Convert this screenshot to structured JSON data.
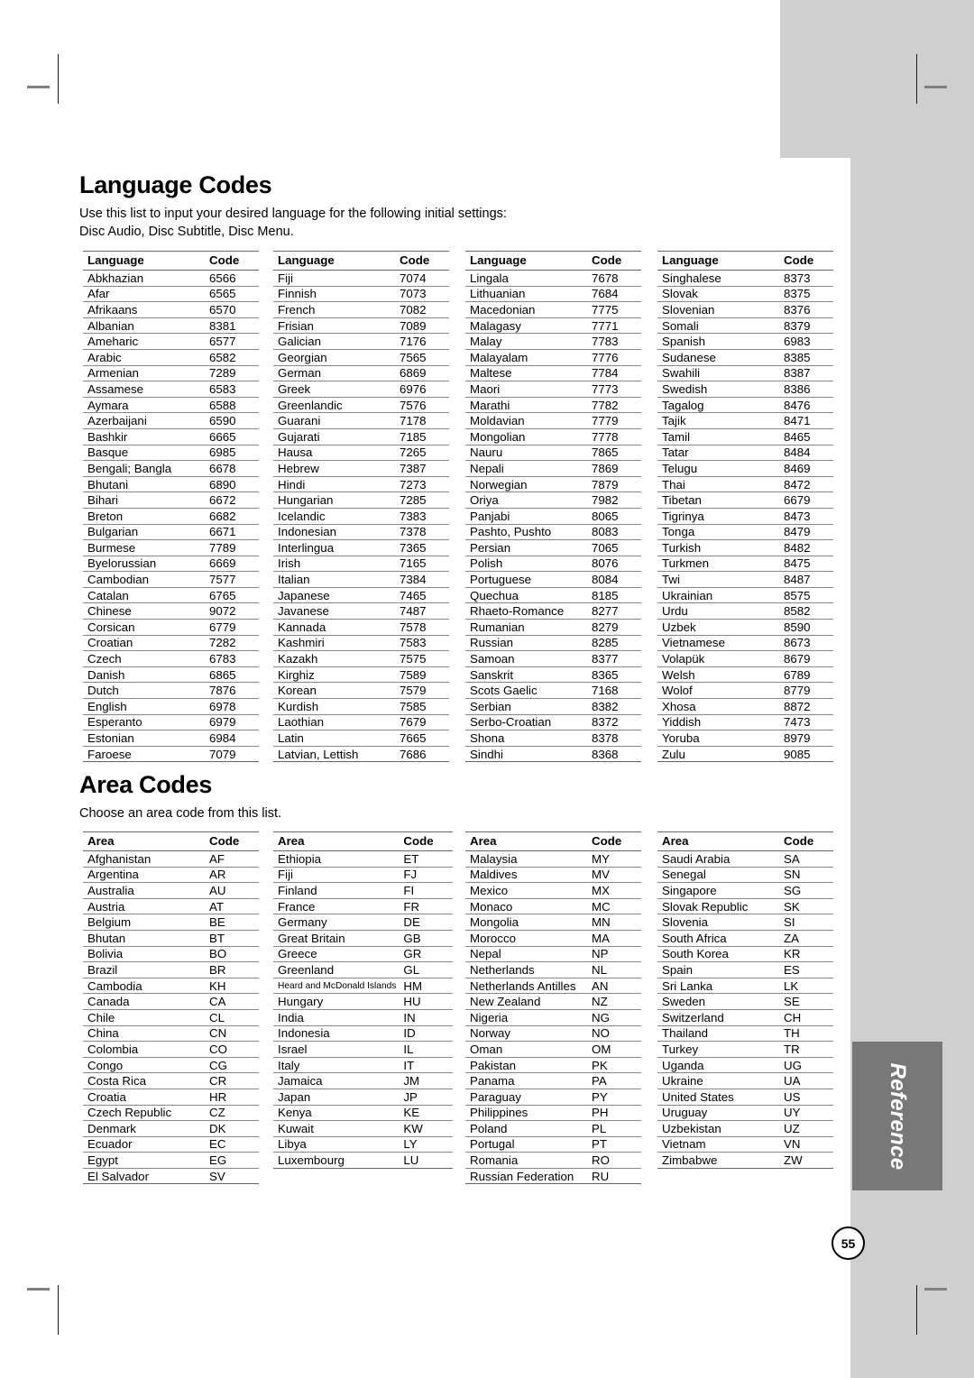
{
  "page": {
    "number": "55",
    "side_tab": "Reference"
  },
  "language_section": {
    "title": "Language Codes",
    "description_line1": "Use this list to input your desired language for the following initial settings:",
    "description_line2": "Disc Audio, Disc Subtitle, Disc Menu.",
    "headers": {
      "name": "Language",
      "code": "Code"
    },
    "columns": [
      [
        [
          "Abkhazian",
          "6566"
        ],
        [
          "Afar",
          "6565"
        ],
        [
          "Afrikaans",
          "6570"
        ],
        [
          "Albanian",
          "8381"
        ],
        [
          "Ameharic",
          "6577"
        ],
        [
          "Arabic",
          "6582"
        ],
        [
          "Armenian",
          "7289"
        ],
        [
          "Assamese",
          "6583"
        ],
        [
          "Aymara",
          "6588"
        ],
        [
          "Azerbaijani",
          "6590"
        ],
        [
          "Bashkir",
          "6665"
        ],
        [
          "Basque",
          "6985"
        ],
        [
          "Bengali; Bangla",
          "6678"
        ],
        [
          "Bhutani",
          "6890"
        ],
        [
          "Bihari",
          "6672"
        ],
        [
          "Breton",
          "6682"
        ],
        [
          "Bulgarian",
          "6671"
        ],
        [
          "Burmese",
          "7789"
        ],
        [
          "Byelorussian",
          "6669"
        ],
        [
          "Cambodian",
          "7577"
        ],
        [
          "Catalan",
          "6765"
        ],
        [
          "Chinese",
          "9072"
        ],
        [
          "Corsican",
          "6779"
        ],
        [
          "Croatian",
          "7282"
        ],
        [
          "Czech",
          "6783"
        ],
        [
          "Danish",
          "6865"
        ],
        [
          "Dutch",
          "7876"
        ],
        [
          "English",
          "6978"
        ],
        [
          "Esperanto",
          "6979"
        ],
        [
          "Estonian",
          "6984"
        ],
        [
          "Faroese",
          "7079"
        ]
      ],
      [
        [
          "Fiji",
          "7074"
        ],
        [
          "Finnish",
          "7073"
        ],
        [
          "French",
          "7082"
        ],
        [
          "Frisian",
          "7089"
        ],
        [
          "Galician",
          "7176"
        ],
        [
          "Georgian",
          "7565"
        ],
        [
          "German",
          "6869"
        ],
        [
          "Greek",
          "6976"
        ],
        [
          "Greenlandic",
          "7576"
        ],
        [
          "Guarani",
          "7178"
        ],
        [
          "Gujarati",
          "7185"
        ],
        [
          "Hausa",
          "7265"
        ],
        [
          "Hebrew",
          "7387"
        ],
        [
          "Hindi",
          "7273"
        ],
        [
          "Hungarian",
          "7285"
        ],
        [
          "Icelandic",
          "7383"
        ],
        [
          "Indonesian",
          "7378"
        ],
        [
          "Interlingua",
          "7365"
        ],
        [
          "Irish",
          "7165"
        ],
        [
          "Italian",
          "7384"
        ],
        [
          "Japanese",
          "7465"
        ],
        [
          "Javanese",
          "7487"
        ],
        [
          "Kannada",
          "7578"
        ],
        [
          "Kashmiri",
          "7583"
        ],
        [
          "Kazakh",
          "7575"
        ],
        [
          "Kirghiz",
          "7589"
        ],
        [
          "Korean",
          "7579"
        ],
        [
          "Kurdish",
          "7585"
        ],
        [
          "Laothian",
          "7679"
        ],
        [
          "Latin",
          "7665"
        ],
        [
          "Latvian, Lettish",
          "7686"
        ]
      ],
      [
        [
          "Lingala",
          "7678"
        ],
        [
          "Lithuanian",
          "7684"
        ],
        [
          "Macedonian",
          "7775"
        ],
        [
          "Malagasy",
          "7771"
        ],
        [
          "Malay",
          "7783"
        ],
        [
          "Malayalam",
          "7776"
        ],
        [
          "Maltese",
          "7784"
        ],
        [
          "Maori",
          "7773"
        ],
        [
          "Marathi",
          "7782"
        ],
        [
          "Moldavian",
          "7779"
        ],
        [
          "Mongolian",
          "7778"
        ],
        [
          "Nauru",
          "7865"
        ],
        [
          "Nepali",
          "7869"
        ],
        [
          "Norwegian",
          "7879"
        ],
        [
          "Oriya",
          "7982"
        ],
        [
          "Panjabi",
          "8065"
        ],
        [
          "Pashto, Pushto",
          "8083"
        ],
        [
          "Persian",
          "7065"
        ],
        [
          "Polish",
          "8076"
        ],
        [
          "Portuguese",
          "8084"
        ],
        [
          "Quechua",
          "8185"
        ],
        [
          "Rhaeto-Romance",
          "8277"
        ],
        [
          "Rumanian",
          "8279"
        ],
        [
          "Russian",
          "8285"
        ],
        [
          "Samoan",
          "8377"
        ],
        [
          "Sanskrit",
          "8365"
        ],
        [
          "Scots Gaelic",
          "7168"
        ],
        [
          "Serbian",
          "8382"
        ],
        [
          "Serbo-Croatian",
          "8372"
        ],
        [
          "Shona",
          "8378"
        ],
        [
          "Sindhi",
          "8368"
        ]
      ],
      [
        [
          "Singhalese",
          "8373"
        ],
        [
          "Slovak",
          "8375"
        ],
        [
          "Slovenian",
          "8376"
        ],
        [
          "Somali",
          "8379"
        ],
        [
          "Spanish",
          "6983"
        ],
        [
          "Sudanese",
          "8385"
        ],
        [
          "Swahili",
          "8387"
        ],
        [
          "Swedish",
          "8386"
        ],
        [
          "Tagalog",
          "8476"
        ],
        [
          "Tajik",
          "8471"
        ],
        [
          "Tamil",
          "8465"
        ],
        [
          "Tatar",
          "8484"
        ],
        [
          "Telugu",
          "8469"
        ],
        [
          "Thai",
          "8472"
        ],
        [
          "Tibetan",
          "6679"
        ],
        [
          "Tigrinya",
          "8473"
        ],
        [
          "Tonga",
          "8479"
        ],
        [
          "Turkish",
          "8482"
        ],
        [
          "Turkmen",
          "8475"
        ],
        [
          "Twi",
          "8487"
        ],
        [
          "Ukrainian",
          "8575"
        ],
        [
          "Urdu",
          "8582"
        ],
        [
          "Uzbek",
          "8590"
        ],
        [
          "Vietnamese",
          "8673"
        ],
        [
          "Volapük",
          "8679"
        ],
        [
          "Welsh",
          "6789"
        ],
        [
          "Wolof",
          "8779"
        ],
        [
          "Xhosa",
          "8872"
        ],
        [
          "Yiddish",
          "7473"
        ],
        [
          "Yoruba",
          "8979"
        ],
        [
          "Zulu",
          "9085"
        ]
      ]
    ]
  },
  "area_section": {
    "title": "Area Codes",
    "description_line1": "Choose an area code from this list.",
    "headers": {
      "name": "Area",
      "code": "Code"
    },
    "columns": [
      [
        [
          "Afghanistan",
          "AF"
        ],
        [
          "Argentina",
          "AR"
        ],
        [
          "Australia",
          "AU"
        ],
        [
          "Austria",
          "AT"
        ],
        [
          "Belgium",
          "BE"
        ],
        [
          "Bhutan",
          "BT"
        ],
        [
          "Bolivia",
          "BO"
        ],
        [
          "Brazil",
          "BR"
        ],
        [
          "Cambodia",
          "KH"
        ],
        [
          "Canada",
          "CA"
        ],
        [
          "Chile",
          "CL"
        ],
        [
          "China",
          "CN"
        ],
        [
          "Colombia",
          "CO"
        ],
        [
          "Congo",
          "CG"
        ],
        [
          "Costa Rica",
          "CR"
        ],
        [
          "Croatia",
          "HR"
        ],
        [
          "Czech Republic",
          "CZ"
        ],
        [
          "Denmark",
          "DK"
        ],
        [
          "Ecuador",
          "EC"
        ],
        [
          "Egypt",
          "EG"
        ],
        [
          "El Salvador",
          "SV"
        ]
      ],
      [
        [
          "Ethiopia",
          "ET"
        ],
        [
          "Fiji",
          "FJ"
        ],
        [
          "Finland",
          "FI"
        ],
        [
          "France",
          "FR"
        ],
        [
          "Germany",
          "DE"
        ],
        [
          "Great Britain",
          "GB"
        ],
        [
          "Greece",
          "GR"
        ],
        [
          "Greenland",
          "GL"
        ],
        [
          "Heard and McDonald Islands",
          "HM"
        ],
        [
          "Hungary",
          "HU"
        ],
        [
          "India",
          "IN"
        ],
        [
          "Indonesia",
          "ID"
        ],
        [
          "Israel",
          "IL"
        ],
        [
          "Italy",
          "IT"
        ],
        [
          "Jamaica",
          "JM"
        ],
        [
          "Japan",
          "JP"
        ],
        [
          "Kenya",
          "KE"
        ],
        [
          "Kuwait",
          "KW"
        ],
        [
          "Libya",
          "LY"
        ],
        [
          "Luxembourg",
          "LU"
        ]
      ],
      [
        [
          "Malaysia",
          "MY"
        ],
        [
          "Maldives",
          "MV"
        ],
        [
          "Mexico",
          "MX"
        ],
        [
          "Monaco",
          "MC"
        ],
        [
          "Mongolia",
          "MN"
        ],
        [
          "Morocco",
          "MA"
        ],
        [
          "Nepal",
          "NP"
        ],
        [
          "Netherlands",
          "NL"
        ],
        [
          "Netherlands Antilles",
          "AN"
        ],
        [
          "New Zealand",
          "NZ"
        ],
        [
          "Nigeria",
          "NG"
        ],
        [
          "Norway",
          "NO"
        ],
        [
          "Oman",
          "OM"
        ],
        [
          "Pakistan",
          "PK"
        ],
        [
          "Panama",
          "PA"
        ],
        [
          "Paraguay",
          "PY"
        ],
        [
          "Philippines",
          "PH"
        ],
        [
          "Poland",
          "PL"
        ],
        [
          "Portugal",
          "PT"
        ],
        [
          "Romania",
          "RO"
        ],
        [
          "Russian Federation",
          "RU"
        ]
      ],
      [
        [
          "Saudi Arabia",
          "SA"
        ],
        [
          "Senegal",
          "SN"
        ],
        [
          "Singapore",
          "SG"
        ],
        [
          "Slovak Republic",
          "SK"
        ],
        [
          "Slovenia",
          "SI"
        ],
        [
          "South Africa",
          "ZA"
        ],
        [
          "South Korea",
          "KR"
        ],
        [
          "Spain",
          "ES"
        ],
        [
          "Sri Lanka",
          "LK"
        ],
        [
          "Sweden",
          "SE"
        ],
        [
          "Switzerland",
          "CH"
        ],
        [
          "Thailand",
          "TH"
        ],
        [
          "Turkey",
          "TR"
        ],
        [
          "Uganda",
          "UG"
        ],
        [
          "Ukraine",
          "UA"
        ],
        [
          "United States",
          "US"
        ],
        [
          "Uruguay",
          "UY"
        ],
        [
          "Uzbekistan",
          "UZ"
        ],
        [
          "Vietnam",
          "VN"
        ],
        [
          "Zimbabwe",
          "ZW"
        ]
      ]
    ]
  }
}
